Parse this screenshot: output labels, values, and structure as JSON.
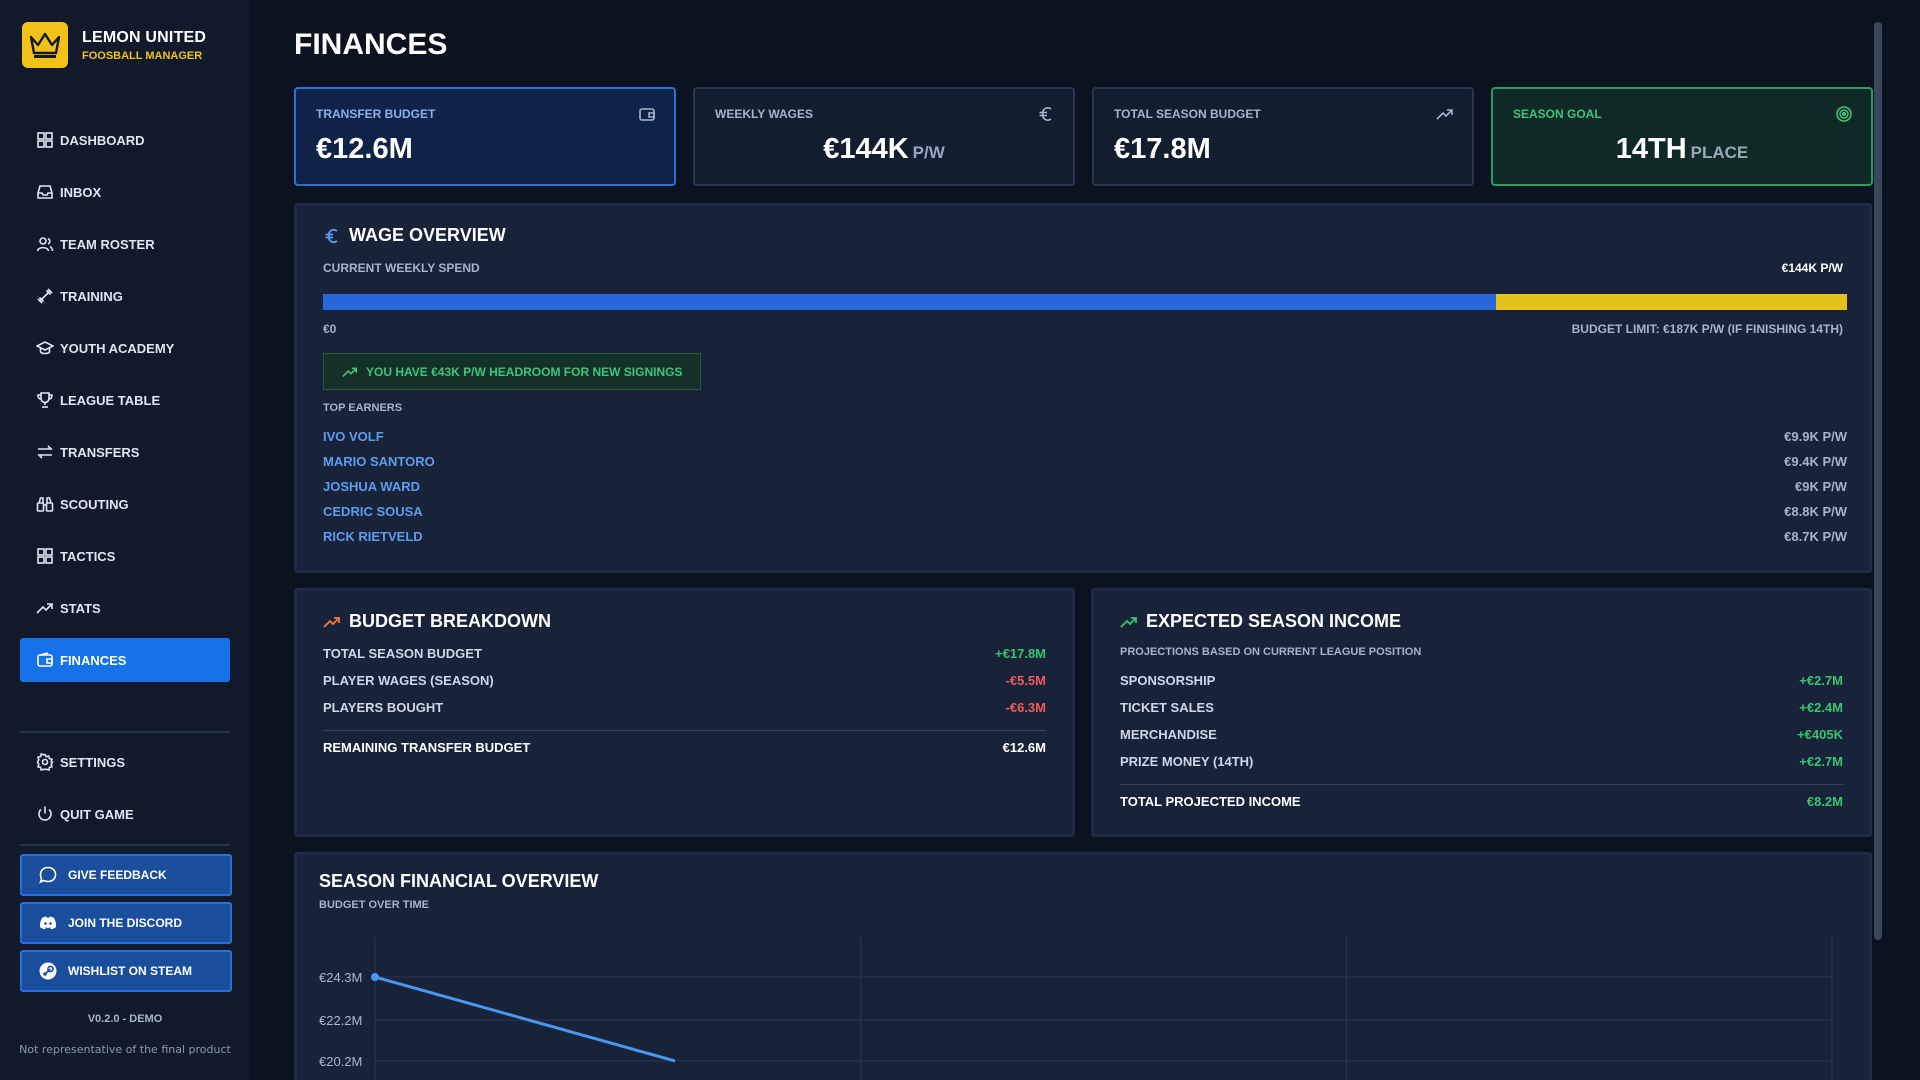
{
  "app": {
    "title": "LEMON UNITED",
    "subtitle": "FOOSBALL MANAGER"
  },
  "nav": {
    "items": [
      {
        "label": "DASHBOARD",
        "icon": "grid-icon"
      },
      {
        "label": "INBOX",
        "icon": "inbox-icon"
      },
      {
        "label": "TEAM ROSTER",
        "icon": "users-icon"
      },
      {
        "label": "TRAINING",
        "icon": "dumbbell-icon"
      },
      {
        "label": "YOUTH ACADEMY",
        "icon": "graduation-cap-icon"
      },
      {
        "label": "LEAGUE TABLE",
        "icon": "trophy-icon"
      },
      {
        "label": "TRANSFERS",
        "icon": "swap-arrows-icon"
      },
      {
        "label": "SCOUTING",
        "icon": "binoculars-icon"
      },
      {
        "label": "TACTICS",
        "icon": "grid-icon"
      },
      {
        "label": "STATS",
        "icon": "trending-up-icon"
      },
      {
        "label": "FINANCES",
        "icon": "wallet-icon",
        "active": true
      }
    ],
    "secondary": [
      {
        "label": "SETTINGS",
        "icon": "gear-icon"
      },
      {
        "label": "QUIT GAME",
        "icon": "power-icon"
      }
    ]
  },
  "external": {
    "feedback": "GIVE FEEDBACK",
    "discord": "JOIN THE DISCORD",
    "steam": "WISHLIST ON STEAM"
  },
  "footer": {
    "version": "V0.2.0 - DEMO",
    "disclaimer": "Not representative of the final product"
  },
  "page": {
    "title": "FINANCES"
  },
  "stats": {
    "transfer_budget": {
      "label": "TRANSFER BUDGET",
      "value": "€12.6M"
    },
    "weekly_wages": {
      "label": "WEEKLY WAGES",
      "value": "€144K",
      "unit": "P/W"
    },
    "total_season_budget": {
      "label": "TOTAL SEASON BUDGET",
      "value": "€17.8M"
    },
    "season_goal": {
      "label": "SEASON GOAL",
      "value": "14TH",
      "unit": "PLACE"
    }
  },
  "wage_overview": {
    "title": "WAGE OVERVIEW",
    "current_label": "CURRENT WEEKLY SPEND",
    "current_value": "€144K P/W",
    "bar_fill_fraction": 0.77,
    "min_label": "€0",
    "limit_label": "BUDGET LIMIT: €187K P/W (IF FINISHING 14TH)",
    "headroom": "YOU HAVE €43K P/W HEADROOM FOR NEW SIGNINGS",
    "top_earners_label": "TOP EARNERS",
    "top_earners": [
      {
        "name": "IVO VOLF",
        "wage": "€9.9K P/W"
      },
      {
        "name": "MARIO SANTORO",
        "wage": "€9.4K P/W"
      },
      {
        "name": "JOSHUA WARD",
        "wage": "€9K P/W"
      },
      {
        "name": "CEDRIC SOUSA",
        "wage": "€8.8K P/W"
      },
      {
        "name": "RICK RIETVELD",
        "wage": "€8.7K P/W"
      }
    ]
  },
  "budget_breakdown": {
    "title": "BUDGET BREAKDOWN",
    "rows": [
      {
        "label": "TOTAL SEASON BUDGET",
        "value": "+€17.8M"
      },
      {
        "label": "PLAYER WAGES (SEASON)",
        "value": "-€5.5M"
      },
      {
        "label": "PLAYERS BOUGHT",
        "value": "-€6.3M"
      }
    ],
    "total_label": "REMAINING TRANSFER BUDGET",
    "total_value": "€12.6M"
  },
  "expected_income": {
    "title": "EXPECTED SEASON INCOME",
    "subtitle": "PROJECTIONS BASED ON CURRENT LEAGUE POSITION",
    "rows": [
      {
        "label": "SPONSORSHIP",
        "value": "+€2.7M"
      },
      {
        "label": "TICKET SALES",
        "value": "+€2.4M"
      },
      {
        "label": "MERCHANDISE",
        "value": "+€405K"
      },
      {
        "label": "PRIZE MONEY (14TH)",
        "value": "+€2.7M"
      }
    ],
    "total_label": "TOTAL PROJECTED INCOME",
    "total_value": "€8.2M"
  },
  "season_overview": {
    "title": "SEASON FINANCIAL OVERVIEW",
    "subtitle": "BUDGET OVER TIME"
  },
  "colors": {
    "accent_blue": "#1572e8",
    "brand_yellow": "#f2c218",
    "positive": "#36c46e",
    "negative": "#ef5a5a",
    "line": "#4a97f0"
  },
  "chart_data": {
    "type": "line",
    "title": "SEASON FINANCIAL OVERVIEW",
    "subtitle": "BUDGET OVER TIME",
    "y_ticks": [
      "€24.3M",
      "€22.2M",
      "€20.2M"
    ],
    "y_tick_values": [
      24.3,
      22.2,
      20.2
    ],
    "series": [
      {
        "values": [
          24.3,
          20.2
        ]
      }
    ],
    "grid": true,
    "legend": "none"
  }
}
